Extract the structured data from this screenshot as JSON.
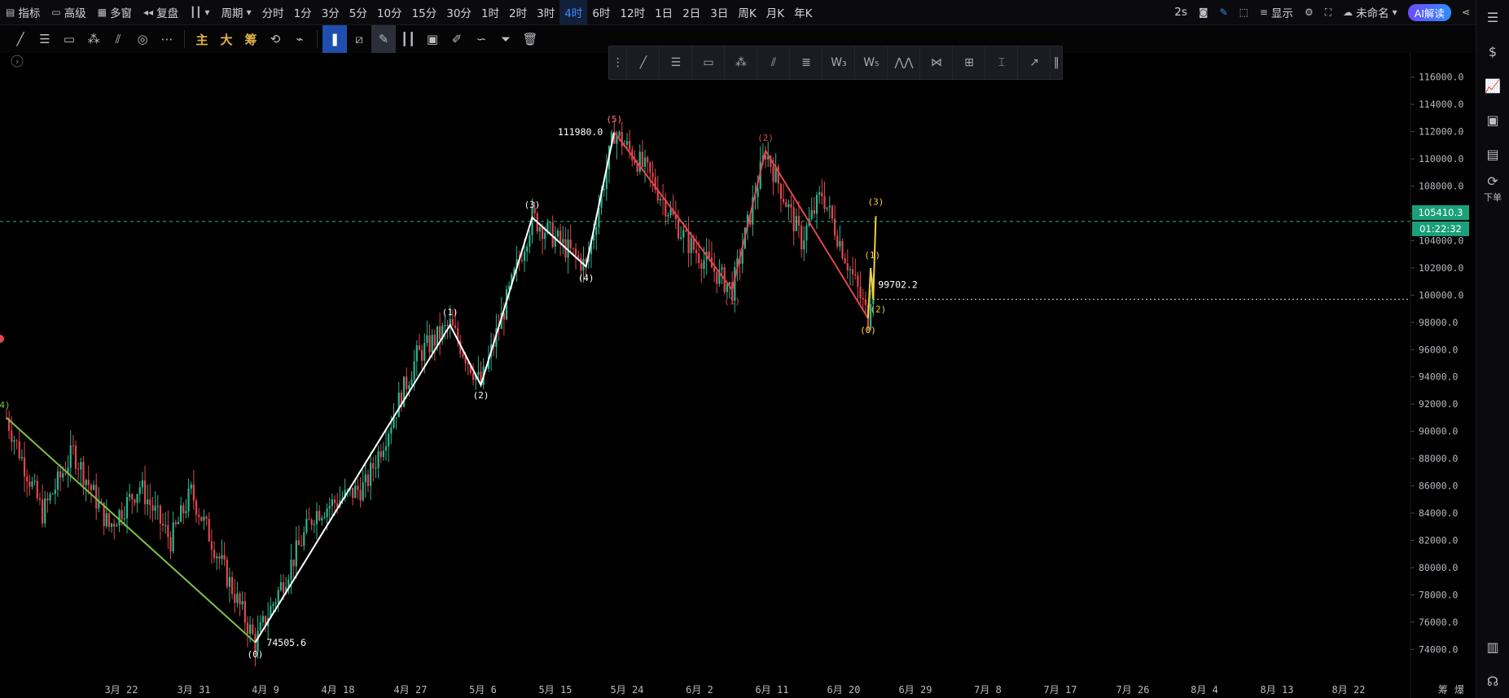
{
  "toolbar": {
    "indicators": "指标",
    "advanced": "高级",
    "multi_window": "多窗",
    "replay": "复盘",
    "period": "周期",
    "periods": [
      "分时",
      "1分",
      "3分",
      "5分",
      "10分",
      "15分",
      "30分",
      "1时",
      "2时",
      "3时",
      "4时",
      "6时",
      "12时",
      "1日",
      "2日",
      "3日",
      "周K",
      "月K",
      "年K"
    ],
    "active_period": "4时",
    "refresh": "2s",
    "display": "显示",
    "layout_name": "未命名",
    "ai_label": "AI解读"
  },
  "draw_toolbar": {
    "main": "主",
    "big": "大",
    "chips": "筹"
  },
  "right_panel": {
    "order_label": "下单"
  },
  "chart_data": {
    "type": "candlestick",
    "y_ticks": [
      "116000.0",
      "114000.0",
      "112000.0",
      "110000.0",
      "108000.0",
      "106000.0",
      "104000.0",
      "102000.0",
      "100000.0",
      "98000.0",
      "96000.0",
      "94000.0",
      "92000.0",
      "90000.0",
      "88000.0",
      "86000.0",
      "84000.0",
      "82000.0",
      "80000.0",
      "78000.0",
      "76000.0",
      "74000.0"
    ],
    "ylim": [
      73000,
      117000
    ],
    "x_ticks": [
      "3月 22",
      "3月 31",
      "4月 9",
      "4月 18",
      "4月 27",
      "5月 6",
      "5月 15",
      "5月 24",
      "6月 2",
      "6月 11",
      "6月 20",
      "6月 29",
      "7月 8",
      "7月 17",
      "7月 26",
      "8月 4",
      "8月 13",
      "8月 22",
      "筹",
      "爆"
    ],
    "current_price": "105410.3",
    "countdown": "01:22:32",
    "price_high_label": "111980.0",
    "price_low_label": "74505.6",
    "price_recent_label": "99702.2",
    "waves_green": [
      {
        "label": "4)",
        "x": 0,
        "y": 91000
      },
      {
        "label": "",
        "x": 97,
        "y": 74505.6
      }
    ],
    "waves_white": [
      {
        "label": "(0)",
        "x": 97,
        "y": 74505.6
      },
      {
        "label": "(1)",
        "x": 173,
        "y": 97800
      },
      {
        "label": "(2)",
        "x": 185,
        "y": 93400
      },
      {
        "label": "(3)",
        "x": 205,
        "y": 105700
      },
      {
        "label": "(4)",
        "x": 226,
        "y": 102100
      },
      {
        "label": "(5)",
        "x": 237,
        "y": 111980
      }
    ],
    "waves_red": [
      {
        "label": "(5)",
        "x": 237,
        "y": 111980
      },
      {
        "label": "(1)",
        "x": 283,
        "y": 100400
      },
      {
        "label": "(2)",
        "x": 296,
        "y": 110600
      },
      {
        "label": "(0)",
        "x": 336,
        "y": 98300
      }
    ],
    "waves_yellow": [
      {
        "label": "(0)",
        "x": 336,
        "y": 98300
      },
      {
        "label": "(1)",
        "x": 337,
        "y": 102000
      },
      {
        "label": "(2)",
        "x": 338,
        "y": 99700
      },
      {
        "label": "(3)",
        "x": 339,
        "y": 105800
      }
    ]
  }
}
